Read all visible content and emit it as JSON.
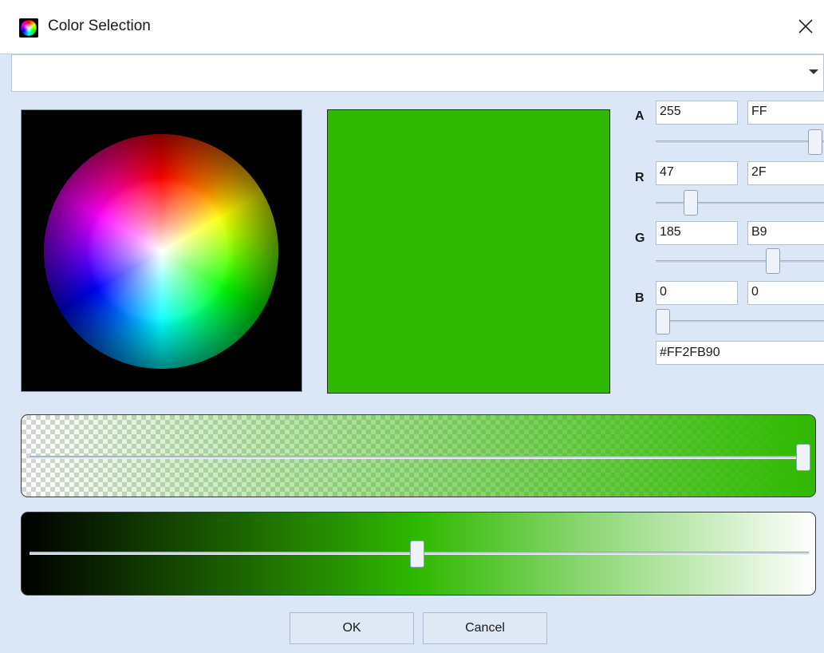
{
  "window": {
    "title": "Color Selection",
    "icon": "color-wheel-icon",
    "close_icon": "close-icon"
  },
  "dropdown": {
    "value": "",
    "icon": "chevron-down-icon"
  },
  "preview": {
    "color": "#2FB900"
  },
  "channels": [
    {
      "label": "A",
      "decimal": "255",
      "hex": "FF",
      "level": 1.0
    },
    {
      "label": "R",
      "decimal": "47",
      "hex": "2F",
      "level": 0.184
    },
    {
      "label": "G",
      "decimal": "185",
      "hex": "B9",
      "level": 0.725
    },
    {
      "label": "B",
      "decimal": "0",
      "hex": "0",
      "level": 0.0
    }
  ],
  "hex_value": "#FF2FB90",
  "alpha_slider": {
    "level": 1.0
  },
  "brightness_slider": {
    "level": 0.5
  },
  "buttons": {
    "ok": "OK",
    "cancel": "Cancel"
  },
  "colors": {
    "selected": "#2FB900",
    "background": "#DBE7F7"
  }
}
